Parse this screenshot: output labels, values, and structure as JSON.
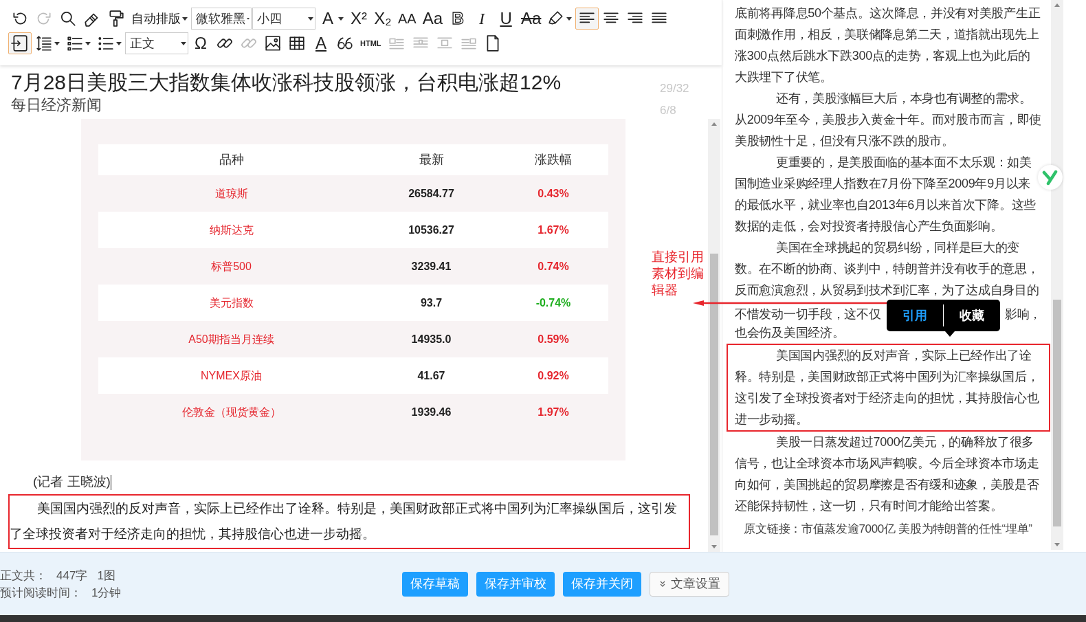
{
  "toolbar": {
    "top_row": [
      {
        "kind": "icon",
        "selected": false,
        "disabled": false,
        "caret": false
      },
      {
        "kind": "icon",
        "selected": false,
        "disabled": true,
        "caret": false
      },
      {
        "kind": "icon",
        "selected": false,
        "disabled": false,
        "caret": false
      },
      {
        "kind": "icon",
        "selected": false,
        "disabled": false,
        "caret": false
      },
      {
        "kind": "icon",
        "selected": false,
        "disabled": false,
        "caret": false
      },
      {
        "kind": "menu",
        "text": "自动排版"
      },
      {
        "kind": "select",
        "value": "微软雅黑"
      },
      {
        "kind": "select",
        "value": "小四"
      },
      {
        "kind": "glyph",
        "text": "A",
        "caret": true
      },
      {
        "kind": "glyph",
        "text": "X²",
        "caret": false
      },
      {
        "kind": "glyph",
        "text": "X₂",
        "caret": false
      },
      {
        "kind": "glyph",
        "text": "AA",
        "caret": false
      },
      {
        "kind": "glyph",
        "text": "Aa",
        "caret": false
      },
      {
        "kind": "glyph",
        "text": "B",
        "caret": false
      },
      {
        "kind": "glyph",
        "text": "I",
        "caret": false
      },
      {
        "kind": "glyph",
        "text": "U",
        "caret": false
      },
      {
        "kind": "glyph",
        "text": "Aa",
        "caret": false
      },
      {
        "kind": "icon",
        "selected": false,
        "disabled": false,
        "caret": true
      },
      {
        "kind": "icon",
        "selected": true,
        "disabled": false,
        "caret": false
      },
      {
        "kind": "icon",
        "selected": false,
        "disabled": false,
        "caret": false
      },
      {
        "kind": "icon",
        "selected": false,
        "disabled": false,
        "caret": false
      },
      {
        "kind": "icon",
        "selected": false,
        "disabled": false,
        "caret": false
      }
    ],
    "bottom_row": [
      {
        "kind": "icon",
        "selected": true,
        "disabled": false,
        "caret": false
      },
      {
        "kind": "icon",
        "selected": false,
        "disabled": false,
        "caret": true
      },
      {
        "kind": "icon",
        "selected": false,
        "disabled": false,
        "caret": true
      },
      {
        "kind": "icon",
        "selected": false,
        "disabled": false,
        "caret": true
      },
      {
        "kind": "select",
        "value": "正文"
      },
      {
        "kind": "glyph",
        "text": "Ω",
        "caret": false
      },
      {
        "kind": "icon",
        "selected": false,
        "disabled": false,
        "caret": false
      },
      {
        "kind": "icon",
        "selected": false,
        "disabled": true,
        "caret": false
      },
      {
        "kind": "icon",
        "selected": false,
        "disabled": false,
        "caret": false
      },
      {
        "kind": "icon",
        "selected": false,
        "disabled": false,
        "caret": false
      },
      {
        "kind": "glyph",
        "text": "A",
        "caret": false
      },
      {
        "kind": "icon",
        "selected": false,
        "disabled": false,
        "caret": false
      },
      {
        "kind": "glyph",
        "text": "HTML",
        "caret": false
      },
      {
        "kind": "icon",
        "selected": false,
        "disabled": true,
        "caret": false
      },
      {
        "kind": "icon",
        "selected": false,
        "disabled": true,
        "caret": false
      },
      {
        "kind": "icon",
        "selected": false,
        "disabled": true,
        "caret": false
      },
      {
        "kind": "icon",
        "selected": false,
        "disabled": true,
        "caret": false
      },
      {
        "kind": "icon",
        "selected": false,
        "disabled": false,
        "caret": false
      }
    ]
  },
  "article": {
    "title": "7月28日美股三大指数集体收涨科技股领涨，台积电涨超12%",
    "source": "每日经济新闻",
    "counters": [
      "29/32",
      "6/8"
    ],
    "table": {
      "columns": [
        "品种",
        "最新",
        "涨跌幅"
      ],
      "rows": [
        {
          "name": "道琼斯",
          "latest": "26584.77",
          "change": "0.43%",
          "color": "#e5262e"
        },
        {
          "name": "纳斯达克",
          "latest": "10536.27",
          "change": "1.67%",
          "color": "#e5262e"
        },
        {
          "name": "标普500",
          "latest": "3239.41",
          "change": "0.74%",
          "color": "#e5262e"
        },
        {
          "name": "美元指数",
          "latest": "93.7",
          "change": "-0.74%",
          "color": "#1fae1f"
        },
        {
          "name": "A50期指当月连续",
          "latest": "14935.0",
          "change": "0.59%",
          "color": "#e5262e"
        },
        {
          "name": "NYMEX原油",
          "latest": "41.67",
          "change": "0.92%",
          "color": "#e5262e"
        },
        {
          "name": "伦敦金（现货黄金）",
          "latest": "1939.46",
          "change": "1.97%",
          "color": "#e5262e"
        }
      ]
    },
    "byline": "(记者 王晓波)",
    "paragraphs": [
      {
        "text": "美国国内强烈的反对声音，实际上已经作出了诠释。特别是，美国财政部正式将中国列为汇率操纵国后，这引发了全球投资者对于经济走向的担忧，其持股信心也进一步动摇。",
        "framed": true
      }
    ]
  },
  "annotation": "直接引用素材到编辑器",
  "source_panel": {
    "paragraphs": [
      {
        "text": "底前将再降息50个基点。这次降息，并没有对美股产生正面刺激作用，相反，美联储降息第二天，道指就出现先上涨300点然后跳水下跌300点的走势，客观上也为此后的大跌埋下了伏笔。",
        "indent": false,
        "framed": false
      },
      {
        "text": "还有，美股涨幅巨大后，本身也有调整的需求。从2009年至今，美股步入黄金十年。而对股市而言，即使美股韧性十足，但没有只涨不跌的股市。",
        "indent": true,
        "framed": false
      },
      {
        "text": "更重要的，是美股面临的基本面不太乐观：如美国制造业采购经理人指数在7月份下降至2009年9月以来的最低水平，就业率也自2013年6月以来首次下降。这些数据的走低，会对投资者持股信心产生负面影响。",
        "indent": true,
        "framed": false
      },
      {
        "text": "美国在全球挑起的贸易纠纷，同样是巨大的变数。在不断的协商、谈判中，特朗普并没有收手的意思，反而愈演愈烈，从贸易到技术到汇率，为了达成自身目的",
        "left_of_popup": "不惜发动一切手段，这不仅",
        "right_of_popup": "影响，",
        "text_end": "也会伤及美国经济。",
        "indent": true,
        "framed": false
      },
      {
        "text": "美国国内强烈的反对声音，实际上已经作出了诠释。特别是，美国财政部正式将中国列为汇率操纵国后，这引发了全球投资者对于经济走向的担忧，其持股信心也进一步动摇。",
        "indent": true,
        "framed": true
      },
      {
        "text": "美股一日蒸发超过7000亿美元，的确释放了很多信号，也让全球资本市场风声鹤唳。今后全球资本市场走向如何，美国挑起的贸易摩擦是否有缓和迹象，美股是否还能保持韧性，这一切，只有时间才能给出答案。",
        "indent": true,
        "framed": false
      }
    ],
    "source_link": "原文链接：市值蒸发逾7000亿 美股为特朗普的任性“埋单”",
    "popup": [
      {
        "label": "引用",
        "selected": true
      },
      {
        "label": "收藏",
        "selected": false
      }
    ]
  },
  "footer": {
    "stats": [
      {
        "label": "正文共：",
        "values": [
          "447字",
          "1图"
        ]
      },
      {
        "label": "预计阅读时间：",
        "values": [
          "1分钟"
        ]
      }
    ],
    "buttons": [
      {
        "label": "保存草稿",
        "kind": "primary"
      },
      {
        "label": "保存并审校",
        "kind": "primary"
      },
      {
        "label": "保存并关闭",
        "kind": "primary"
      },
      {
        "label": "文章设置",
        "kind": "outline"
      }
    ]
  }
}
